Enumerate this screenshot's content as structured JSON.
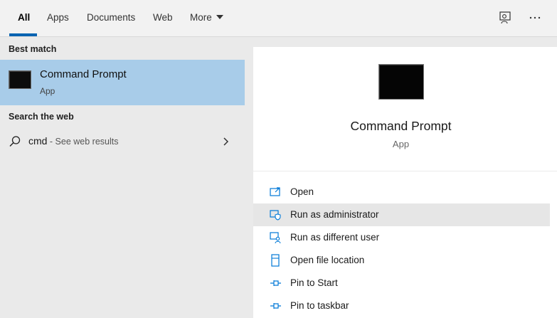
{
  "tabs": [
    {
      "label": "All",
      "active": true
    },
    {
      "label": "Apps"
    },
    {
      "label": "Documents"
    },
    {
      "label": "Web"
    },
    {
      "label": "More"
    }
  ],
  "top_icons": [
    "feedback-icon",
    "more-options-icon"
  ],
  "best_match": {
    "heading": "Best match",
    "title": "Command Prompt",
    "subtitle": "App"
  },
  "search_web": {
    "heading": "Search the web",
    "query": "cmd",
    "hint": " - See web results"
  },
  "preview": {
    "title": "Command Prompt",
    "subtitle": "App"
  },
  "actions": [
    {
      "label": "Open",
      "icon": "open-icon"
    },
    {
      "label": "Run as administrator",
      "icon": "shield-icon",
      "highlighted": true
    },
    {
      "label": "Run as different user",
      "icon": "user-icon"
    },
    {
      "label": "Open file location",
      "icon": "file-location-icon"
    },
    {
      "label": "Pin to Start",
      "icon": "pin-icon"
    },
    {
      "label": "Pin to taskbar",
      "icon": "pin-icon"
    }
  ],
  "colors": {
    "accent": "#0063b1",
    "selected_row": "#a8cce9",
    "icon_blue": "#0078d7"
  }
}
